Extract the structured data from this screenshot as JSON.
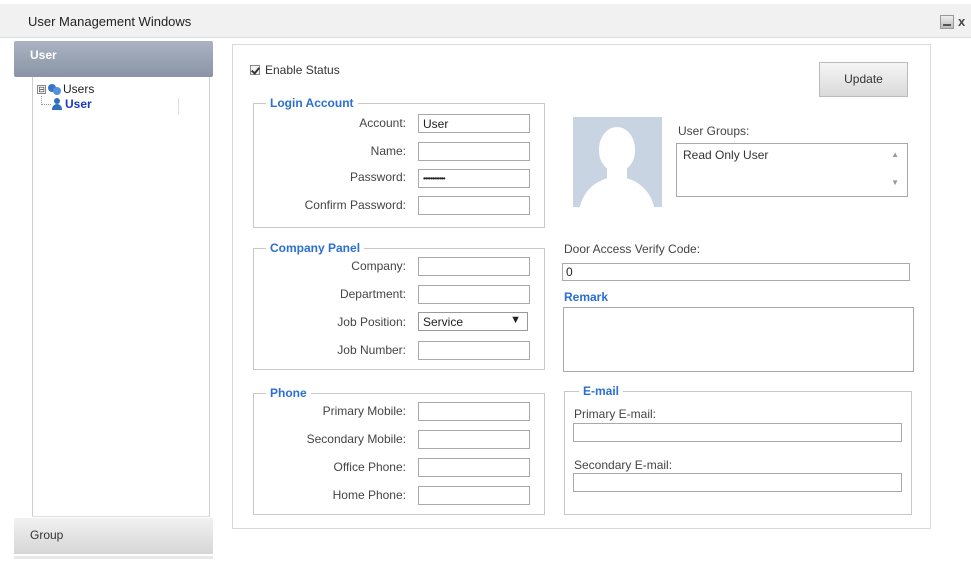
{
  "window": {
    "title": "User Management Windows",
    "minimize_icon": "minimize-icon",
    "close_icon": "close-icon",
    "close_glyph": "x"
  },
  "sidebar": {
    "header": "User",
    "tree": {
      "root_label": "Users",
      "root_expander": "⊟",
      "child_label": "User"
    },
    "group_label": "Group"
  },
  "form": {
    "enable_status_label": "Enable Status",
    "enable_status_checked": true,
    "update_button": "Update",
    "login_account": {
      "legend": "Login Account",
      "account_label": "Account:",
      "account_value": "User",
      "name_label": "Name:",
      "name_value": "",
      "password_label": "Password:",
      "password_value": "••••••••••••",
      "confirm_password_label": "Confirm Password:",
      "confirm_password_value": ""
    },
    "company_panel": {
      "legend": "Company Panel",
      "company_label": "Company:",
      "company_value": "",
      "department_label": "Department:",
      "department_value": "",
      "job_position_label": "Job Position:",
      "job_position_value": "Service",
      "job_position_arrow": "▼",
      "job_number_label": "Job Number:",
      "job_number_value": ""
    },
    "phone": {
      "legend": "Phone",
      "primary_mobile_label": "Primary Mobile:",
      "secondary_mobile_label": "Secondary Mobile:",
      "office_phone_label": "Office Phone:",
      "home_phone_label": "Home Phone:"
    },
    "user_groups": {
      "label": "User Groups:",
      "items": [
        "Read Only User"
      ],
      "scroll_up": "▲",
      "scroll_down": "▼"
    },
    "door_access": {
      "label": "Door Access Verify Code:",
      "value": "0"
    },
    "remark": {
      "label": "Remark",
      "value": ""
    },
    "email": {
      "legend": "E-mail",
      "primary_label": "Primary E-mail:",
      "secondary_label": "Secondary E-mail:"
    }
  },
  "colors": {
    "accent_blue": "#2a6fd1",
    "tree_selected": "#1c36c9",
    "header_bg": "#8a94a6"
  }
}
